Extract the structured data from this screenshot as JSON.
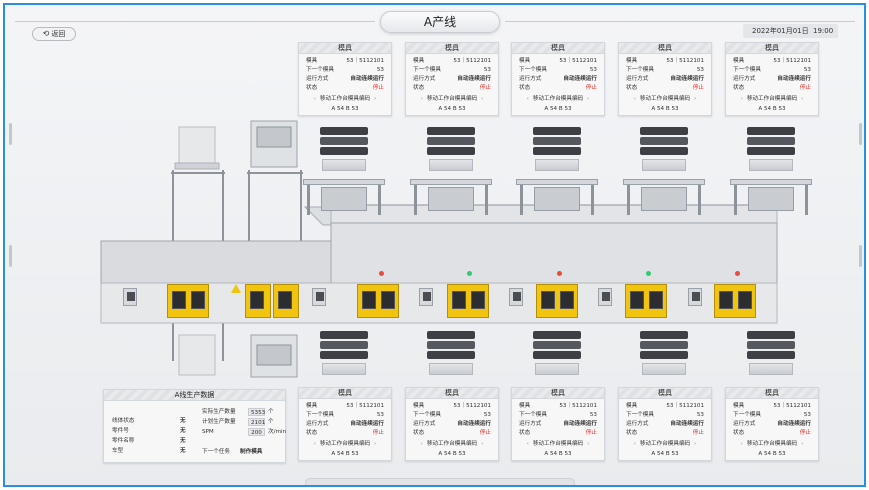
{
  "header": {
    "title": "A产线",
    "back_label": "返回",
    "back_icon": "undo-arrow-icon",
    "date": "2022年01月01日",
    "time": "19:00"
  },
  "card_common": {
    "title": "模具",
    "die_label": "模具",
    "die_value": "53｜5112101",
    "next_label": "下一个模具",
    "next_value": "53",
    "mode_label": "运行方式",
    "mode_value": "自动连续运行",
    "status_label": "状态",
    "status_value": "停止",
    "move_label": "移动工作台模具编码",
    "codes": "A 54  B 53"
  },
  "stats": {
    "title": "A线生产数据",
    "left": [
      {
        "label": "线体状态",
        "value": "无"
      },
      {
        "label": "零件号",
        "value": "无"
      },
      {
        "label": "零件名称",
        "value": "无"
      },
      {
        "label": "车型",
        "value": "无"
      }
    ],
    "right": [
      {
        "label": "实际生产数量",
        "value": "5353",
        "unit": "个"
      },
      {
        "label": "计划生产数量",
        "value": "2101",
        "unit": "个"
      },
      {
        "label": "SPM",
        "value": "200",
        "unit": "次/min"
      }
    ],
    "task_label": "下一个任务",
    "task_value": "制作模具"
  },
  "colors": {
    "accent": "#2a8fe0",
    "door": "#f1c40f",
    "stop": "#e0302b"
  }
}
